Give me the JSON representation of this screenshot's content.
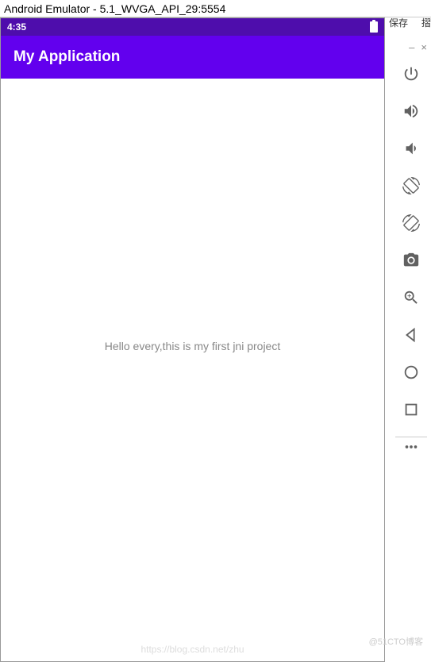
{
  "window": {
    "title": "Android Emulator - 5.1_WVGA_API_29:5554"
  },
  "statusbar": {
    "time": "4:35"
  },
  "appbar": {
    "title": "My Application"
  },
  "content": {
    "message": "Hello every,this is my first jni project"
  },
  "partial": {
    "text1": "保存",
    "text2": "摺"
  },
  "sidecontrols": {
    "minimize": "–",
    "close": "×"
  },
  "watermark": {
    "text1": "https://blog.csdn.net/zhu",
    "text2": "@51CTO博客"
  }
}
